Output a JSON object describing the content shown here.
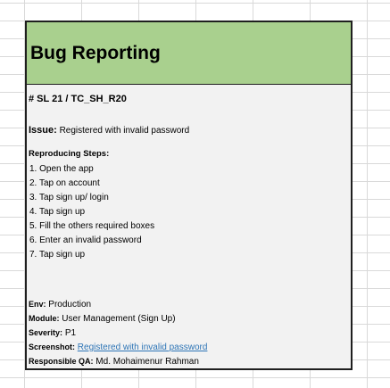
{
  "card": {
    "title": "Bug Reporting",
    "id": "# SL 21 / TC_SH_R20",
    "issue_label": "Issue:",
    "issue_text": "Registered with invalid password",
    "steps_title": "Reproducing Steps:",
    "steps": [
      "1. Open the app",
      "2. Tap on account",
      "3. Tap sign up/ login",
      "4. Tap sign up",
      "5. Fill the others required boxes",
      "6. Enter an invalid password",
      "7. Tap sign up"
    ],
    "env_label": "Env:",
    "env_value": "Production",
    "module_label": "Module:",
    "module_value": "User Management (Sign Up)",
    "severity_label": "Severity:",
    "severity_value": "P1",
    "screenshot_label": "Screenshot:",
    "screenshot_link": "Registered with invalid password",
    "qa_label": "Responsible QA:",
    "qa_value": "Md. Mohaimenur Rahman"
  },
  "colors": {
    "header_bg": "#a9d08e",
    "card_bg": "#f2f2f2",
    "link": "#2e75b6",
    "border": "#1f1f1f"
  }
}
